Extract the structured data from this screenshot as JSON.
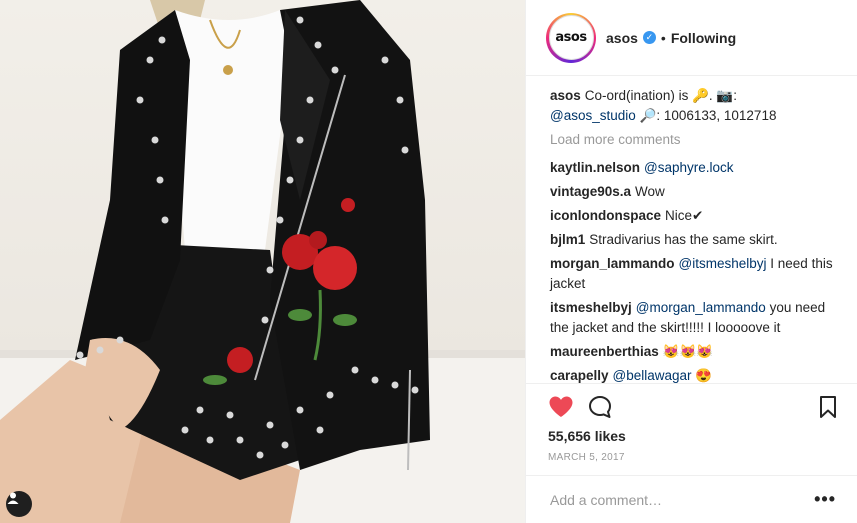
{
  "post": {
    "image_alt": "",
    "header": {
      "avatar_text": "asos",
      "username": "asos",
      "verified_mark": "✓",
      "separator": "•",
      "follow_status": "Following"
    },
    "caption": {
      "user": "asos",
      "text_prefix": "Co-ord(ination) is 🔑. 📷:",
      "mention": "@asos_studio",
      "text_suffix": "🔎: 1006133, 1012718"
    },
    "load_more": "Load more comments",
    "comments": [
      {
        "user": "kaytlin.nelson",
        "mention": "@saphyre.lock",
        "text": ""
      },
      {
        "user": "vintage90s.a",
        "mention": "",
        "text": "Wow"
      },
      {
        "user": "iconlondonspace",
        "mention": "",
        "text": "Nice✔"
      },
      {
        "user": "bjlm1",
        "mention": "",
        "text": "Stradivarius has the same skirt."
      },
      {
        "user": "morgan_lammando",
        "mention": "@itsmeshelbyj",
        "text": "I need this jacket"
      },
      {
        "user": "itsmeshelbyj",
        "mention": "@morgan_lammando",
        "text": "you need the jacket and the skirt!!!!! I looooove it"
      },
      {
        "user": "maureenberthias",
        "mention": "",
        "text": "😻😻😻"
      },
      {
        "user": "carapelly",
        "mention": "@bellawagar",
        "text": "😍"
      }
    ],
    "likes": "55,656 likes",
    "date": "MARCH 5, 2017",
    "add_comment_placeholder": "Add a comment…",
    "more_options": "•••",
    "icons": {
      "like": "heart-icon",
      "comment": "comment-bubble-icon",
      "save": "bookmark-icon",
      "user_tag": "user-tag-icon"
    },
    "colors": {
      "like": "#ed4956",
      "mention": "#003569",
      "verified": "#3897f0",
      "muted": "#999999"
    }
  }
}
